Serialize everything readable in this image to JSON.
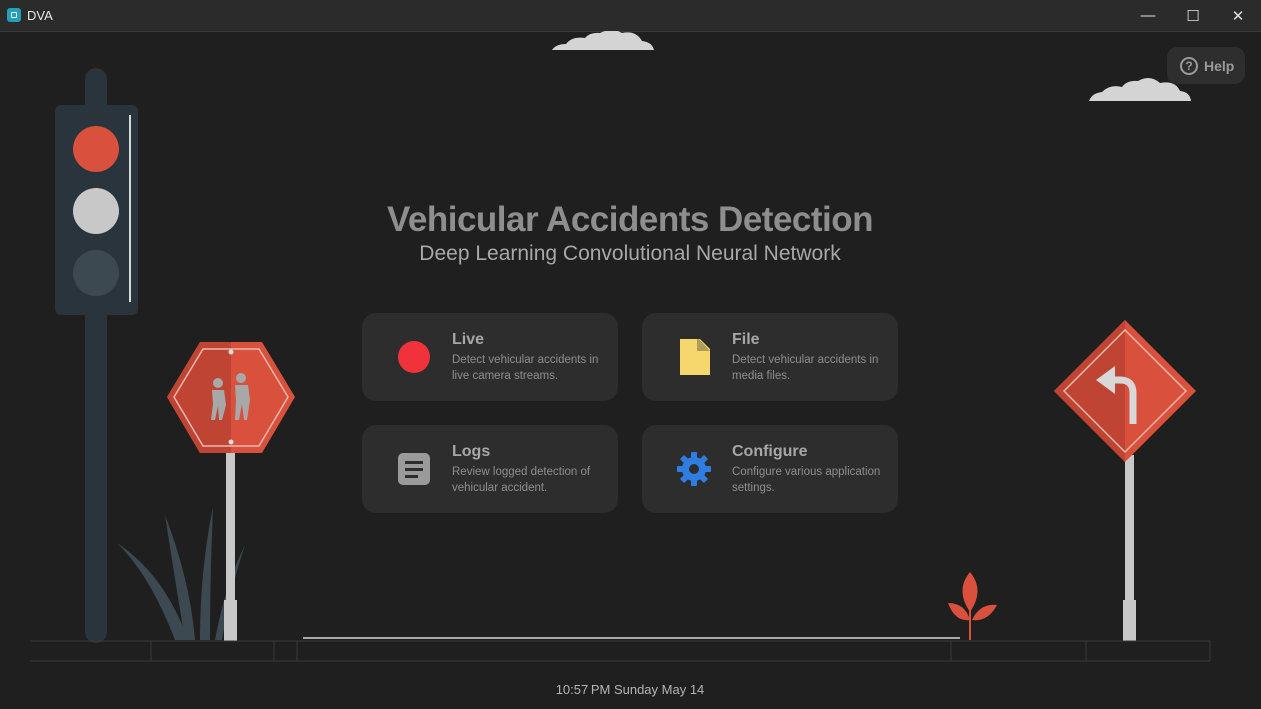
{
  "window": {
    "title": "DVA",
    "minimize_glyph": "—",
    "maximize_glyph": "☐",
    "close_glyph": "✕"
  },
  "help": {
    "label": "Help",
    "icon": "question-circle-icon"
  },
  "header": {
    "title": "Vehicular Accidents Detection",
    "subtitle": "Deep Learning Convolutional Neural Network"
  },
  "cards": [
    {
      "label": "Live",
      "description": "Detect vehicular accidents in live camera streams.",
      "icon": "record-dot-icon",
      "color": "#f0323c"
    },
    {
      "label": "File",
      "description": "Detect vehicular accidents in media files.",
      "icon": "file-icon",
      "color": "#f5d76e"
    },
    {
      "label": "Logs",
      "description": "Review logged detection of vehicular accident.",
      "icon": "logs-icon",
      "color": "#9a9a9a"
    },
    {
      "label": "Configure",
      "description": "Configure various application settings.",
      "icon": "gear-icon",
      "color": "#2f7de1"
    }
  ],
  "footer": {
    "datetime": "10:57 PM Sunday May 14"
  },
  "colors": {
    "background": "#1f1f1f",
    "card": "#2d2d2d",
    "sign_red": "#d9503c",
    "traffic_pole": "#2a343c"
  }
}
